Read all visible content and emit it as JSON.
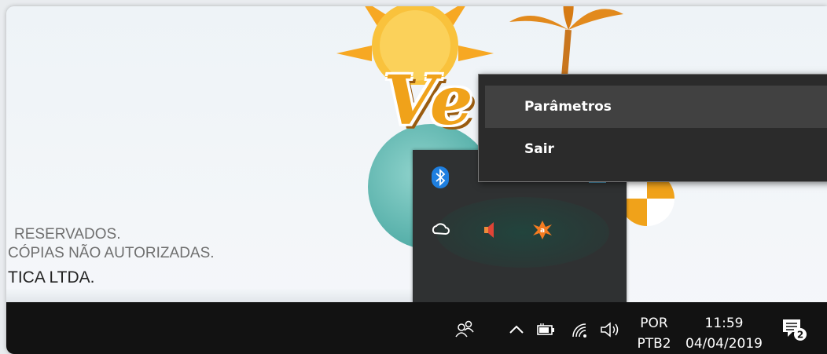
{
  "wallpaper": {
    "copyright_lines": [
      "RESERVADOS.",
      "CÓPIAS NÃO AUTORIZADAS.",
      "TICA LTDA."
    ],
    "logo_fragment": "Ve"
  },
  "context_menu": {
    "items": [
      {
        "label": "Parâmetros"
      },
      {
        "label": "Sair"
      }
    ]
  },
  "tray_flyout": {
    "icons": [
      "bluetooth-icon",
      "creative-cloud-icon",
      "speaker-muted-icon",
      "avast-icon"
    ]
  },
  "taskbar": {
    "icons": [
      "people-icon",
      "show-hidden-icons-chevron",
      "battery-icon",
      "wifi-icon",
      "volume-icon",
      "notifications-icon"
    ],
    "input_language": "POR",
    "keyboard_layout": "PTB2",
    "time": "11:59",
    "date": "04/04/2019",
    "notification_count": "2"
  },
  "colors": {
    "taskbar_bg": "#121212",
    "menu_bg": "#2b2b2b",
    "menu_hover": "#414141",
    "tray_flyout_bg": "#2f3132",
    "avast_orange": "#f47b20",
    "bluetooth_blue": "#1e7fe0"
  }
}
